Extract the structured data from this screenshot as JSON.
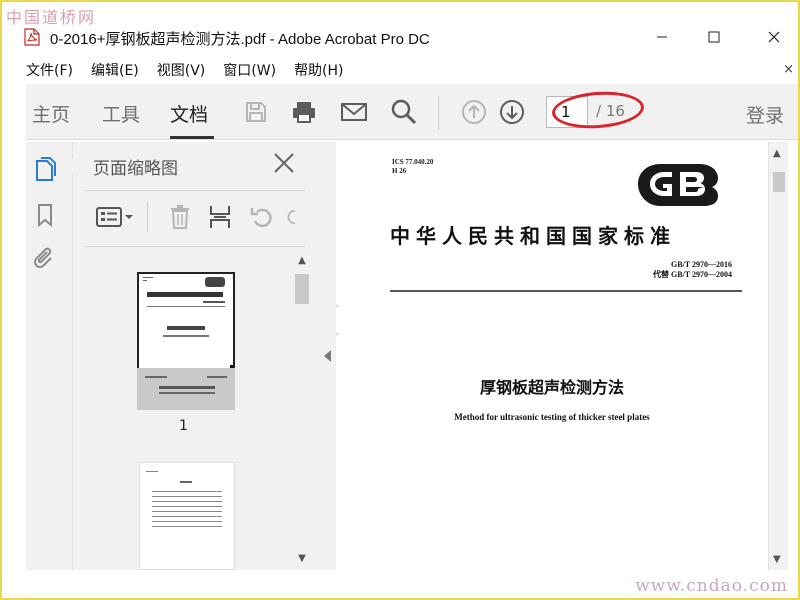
{
  "watermark": {
    "top": "中国道桥网",
    "bottom": "www.cndao.com"
  },
  "window": {
    "title": "0-2016+厚钢板超声检测方法.pdf - Adobe Acrobat Pro DC",
    "icon": "pdf-file-icon"
  },
  "menu": {
    "items": [
      "文件(F)",
      "编辑(E)",
      "视图(V)",
      "窗口(W)",
      "帮助(H)"
    ],
    "close_glyph": "×"
  },
  "toolbar": {
    "tabs": [
      "主页",
      "工具",
      "文档"
    ],
    "active_tab": "文档",
    "icons": [
      "save-icon",
      "print-icon",
      "email-icon",
      "search-icon",
      "page-up-icon",
      "page-down-icon"
    ],
    "current_page": "1",
    "total_pages": "/ 16",
    "login": "登录"
  },
  "left_strip": {
    "icons": [
      "page-thumbnails-icon",
      "bookmark-icon",
      "attachment-icon"
    ]
  },
  "thumbnail_panel": {
    "title": "页面缩略图",
    "tool_icons": [
      "thumbnail-options-icon",
      "delete-icon",
      "extract-icon",
      "rotate-ccw-icon",
      "rotate-cw-icon"
    ],
    "thumbnails": [
      {
        "label": "1"
      }
    ]
  },
  "document": {
    "ics": "ICS 77.040.20",
    "h": "H 26",
    "logo": "GB",
    "standard_title": "中华人民共和国国家标准",
    "code": "GB/T 2970—2016",
    "replaces": "代替 GB/T 2970—2004",
    "title_cn": "厚钢板超声检测方法",
    "title_en": "Method for ultrasonic testing of thicker steel plates"
  },
  "colors": {
    "annotation": "#d9252a",
    "outer_frame": "#ecd64a",
    "icon_blue": "#2a7bd1",
    "icon_gray": "#8a8a8a"
  }
}
